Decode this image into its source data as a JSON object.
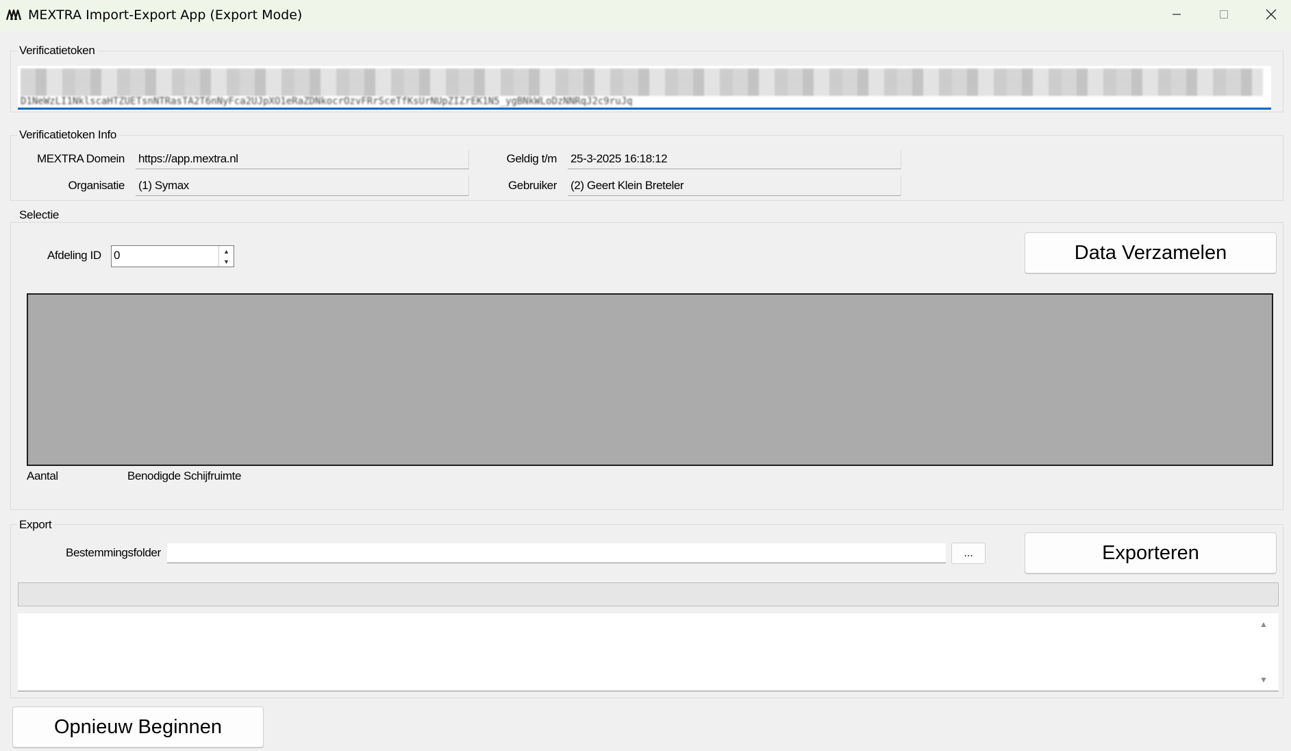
{
  "window": {
    "title": "MEXTRA Import-Export App (Export Mode)"
  },
  "token_group": {
    "legend": "Verificatietoken",
    "token_value_obscured": "D1NeWzLI1NklscaHTZUETsnNTRasTA2T6nNyFca2UJpXO1eRaZDNkocrOzvFRrSceTfKsUrNUpZIZrEK1N5_ygBNkWLoDzNNRqJ2c9ruJq"
  },
  "info_group": {
    "legend": "Verificatietoken Info",
    "domain_label": "MEXTRA Domein",
    "domain_value": "https://app.mextra.nl",
    "valid_label": "Geldig t/m",
    "valid_value": "25-3-2025 16:18:12",
    "org_label": "Organisatie",
    "org_value": "(1) Symax",
    "user_label": "Gebruiker",
    "user_value": "(2) Geert Klein Breteler"
  },
  "selection_group": {
    "legend": "Selectie",
    "department_label": "Afdeling ID",
    "department_value": "0",
    "collect_button": "Data Verzamelen",
    "count_label": "Aantal",
    "space_label": "Benodigde Schijfruimte"
  },
  "export_group": {
    "legend": "Export",
    "folder_label": "Bestemmingsfolder",
    "folder_value": "",
    "browse_button": "...",
    "export_button": "Exporteren",
    "progress": 0,
    "log_text": ""
  },
  "restart_button": "Opnieuw Beginnen",
  "icons": {
    "app": "mextra-logo-icon",
    "minimize": "minimize-icon",
    "maximize": "maximize-icon",
    "close": "close-icon"
  }
}
